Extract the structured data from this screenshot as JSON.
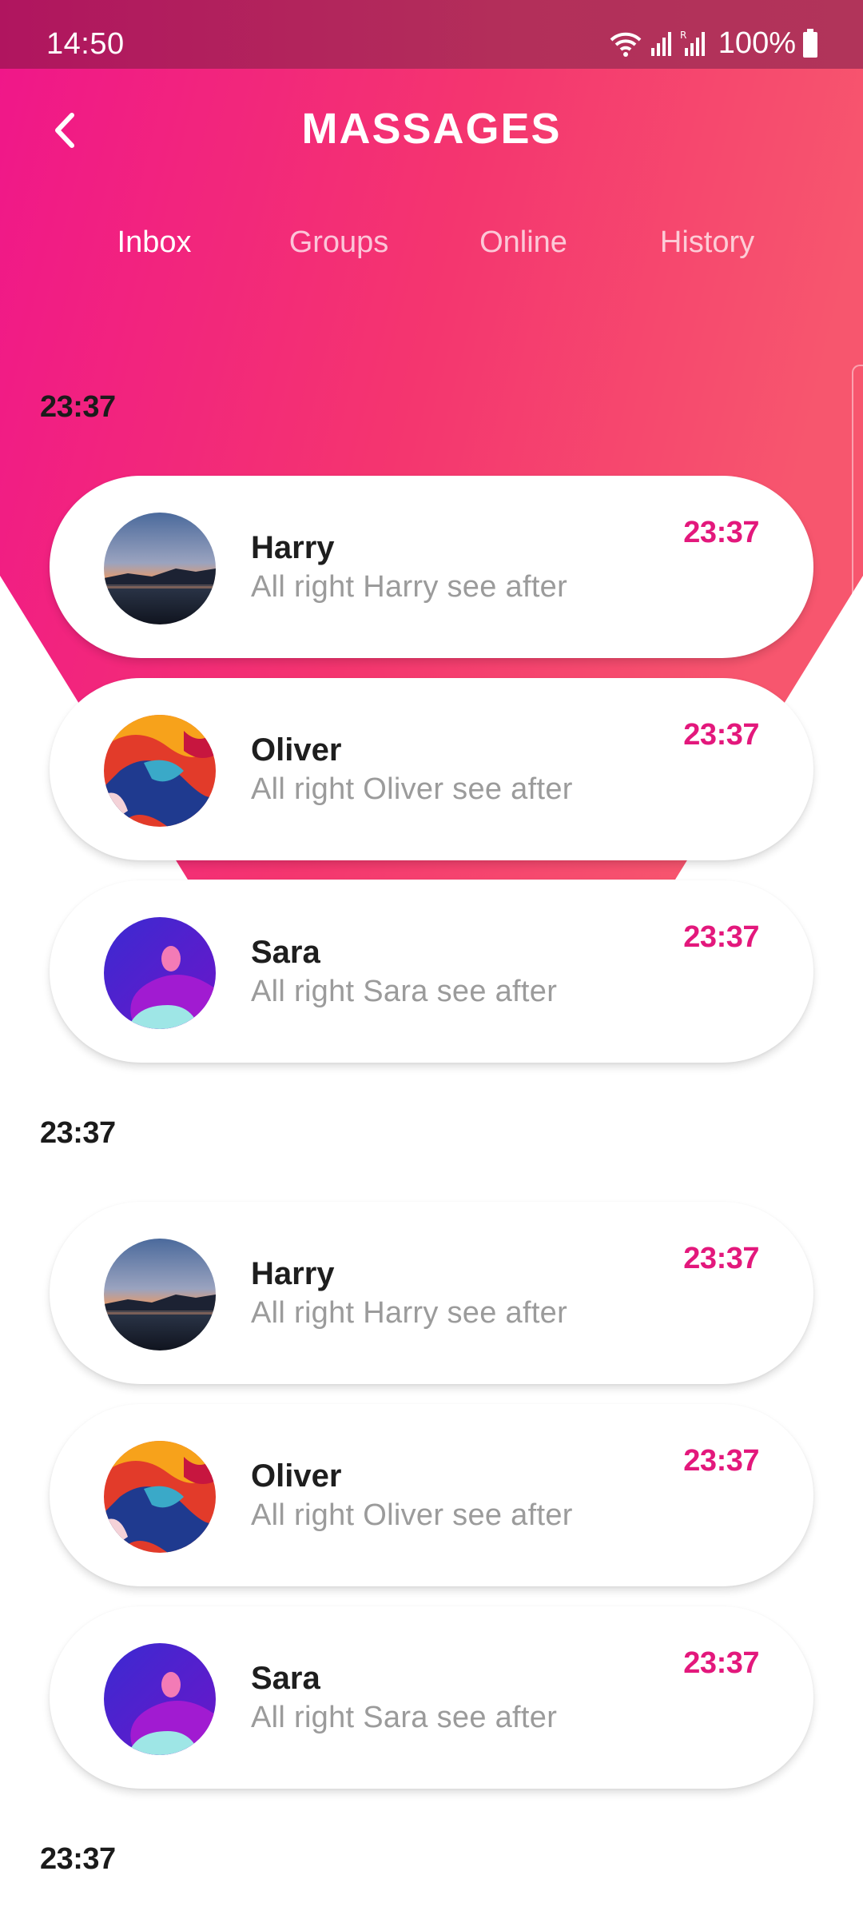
{
  "status_bar": {
    "time": "14:50",
    "battery": "100%",
    "icons": [
      "wifi-icon",
      "signal-icon",
      "signal-icon",
      "battery-icon"
    ]
  },
  "header": {
    "back_icon": "chevron-left-icon",
    "title": "MASSAGES"
  },
  "tabs": [
    {
      "label": "Inbox",
      "active": true
    },
    {
      "label": "Groups",
      "active": false
    },
    {
      "label": "Online",
      "active": false
    },
    {
      "label": "History",
      "active": false
    }
  ],
  "sections": [
    {
      "time": "23:37",
      "conversations": [
        {
          "name": "Harry",
          "preview": "All right Harry see after",
          "time": "23:37",
          "avatar": "sunset-landscape"
        },
        {
          "name": "Oliver",
          "preview": "All right Oliver see after",
          "time": "23:37",
          "avatar": "colorful-abstract"
        },
        {
          "name": "Sara",
          "preview": "All right Sara see after",
          "time": "23:37",
          "avatar": "purple-abstract"
        }
      ]
    },
    {
      "time": "23:37",
      "conversations": [
        {
          "name": "Harry",
          "preview": "All right Harry see after",
          "time": "23:37",
          "avatar": "sunset-landscape"
        },
        {
          "name": "Oliver",
          "preview": "All right Oliver see after",
          "time": "23:37",
          "avatar": "colorful-abstract"
        },
        {
          "name": "Sara",
          "preview": "All right Sara see after",
          "time": "23:37",
          "avatar": "purple-abstract"
        }
      ]
    },
    {
      "time": "23:37",
      "conversations": []
    }
  ],
  "colors": {
    "accent": "#e3187c",
    "gradient_start": "#f0168a",
    "gradient_end": "#f7566e",
    "status_bar": "#b0155f"
  }
}
